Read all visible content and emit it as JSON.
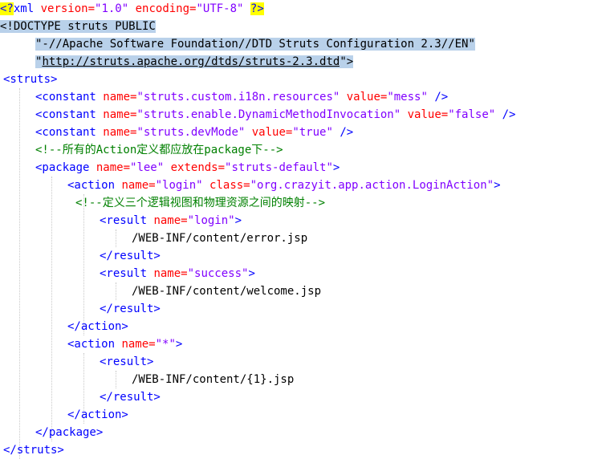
{
  "code_lines": [
    {
      "indent": 0,
      "tokens": [
        {
          "text": "<?",
          "c": "pi",
          "h": "yellow"
        },
        {
          "text": "xml",
          "c": "pi"
        },
        {
          "text": " version=",
          "c": "attr"
        },
        {
          "text": "\"1.0\"",
          "c": "val"
        },
        {
          "text": " encoding=",
          "c": "attr"
        },
        {
          "text": "\"UTF-8\"",
          "c": "val"
        },
        {
          "text": " ",
          "c": "txt"
        },
        {
          "text": "?>",
          "c": "pi",
          "h": "yellow"
        }
      ]
    },
    {
      "indent": 0,
      "tokens": [
        {
          "text": "<!DOCTYPE struts PUBLIC",
          "c": "txt",
          "h": "blue"
        }
      ]
    },
    {
      "indent": 4,
      "tokens": [
        {
          "text": "\"-//Apache Software Foundation//DTD Struts Configuration 2.3//EN\"",
          "c": "txt",
          "h": "blue"
        }
      ]
    },
    {
      "indent": 4,
      "tokens": [
        {
          "text": "\"",
          "c": "txt",
          "h": "blue"
        },
        {
          "text": "http://struts.apache.org/dtds/struts-2.3.dtd",
          "c": "txt",
          "h": "blue",
          "u": true
        },
        {
          "text": "\">",
          "c": "txt",
          "h": "blue"
        }
      ]
    },
    {
      "indent": 0,
      "tokens": [
        {
          "text": "<struts>",
          "c": "tag"
        }
      ]
    },
    {
      "indent": 4,
      "tokens": [
        {
          "text": "<constant",
          "c": "tag"
        },
        {
          "text": " name=",
          "c": "attr"
        },
        {
          "text": "\"struts.custom.i18n.resources\"",
          "c": "val"
        },
        {
          "text": " value=",
          "c": "attr"
        },
        {
          "text": "\"mess\"",
          "c": "val"
        },
        {
          "text": " />",
          "c": "tag"
        }
      ]
    },
    {
      "indent": 4,
      "tokens": [
        {
          "text": "<constant",
          "c": "tag"
        },
        {
          "text": " name=",
          "c": "attr"
        },
        {
          "text": "\"struts.enable.DynamicMethodInvocation\"",
          "c": "val"
        },
        {
          "text": " value=",
          "c": "attr"
        },
        {
          "text": "\"false\"",
          "c": "val"
        },
        {
          "text": " />",
          "c": "tag"
        }
      ]
    },
    {
      "indent": 4,
      "tokens": [
        {
          "text": "<constant",
          "c": "tag"
        },
        {
          "text": " name=",
          "c": "attr"
        },
        {
          "text": "\"struts.devMode\"",
          "c": "val"
        },
        {
          "text": " value=",
          "c": "attr"
        },
        {
          "text": "\"true\"",
          "c": "val"
        },
        {
          "text": " />",
          "c": "tag"
        }
      ]
    },
    {
      "indent": 4,
      "tokens": [
        {
          "text": "<!--所有的Action定义都应放在package下-->",
          "c": "cmt"
        }
      ]
    },
    {
      "indent": 4,
      "tokens": [
        {
          "text": "<package",
          "c": "tag"
        },
        {
          "text": " name=",
          "c": "attr"
        },
        {
          "text": "\"lee\"",
          "c": "val"
        },
        {
          "text": " extends=",
          "c": "attr"
        },
        {
          "text": "\"struts-default\"",
          "c": "val"
        },
        {
          "text": ">",
          "c": "tag"
        }
      ]
    },
    {
      "indent": 8,
      "tokens": [
        {
          "text": "<action",
          "c": "tag"
        },
        {
          "text": " name=",
          "c": "attr"
        },
        {
          "text": "\"login\"",
          "c": "val"
        },
        {
          "text": " class=",
          "c": "attr"
        },
        {
          "text": "\"org.crazyit.app.action.LoginAction\"",
          "c": "val"
        },
        {
          "text": ">",
          "c": "tag"
        }
      ]
    },
    {
      "indent": 9,
      "tokens": [
        {
          "text": "<!--定义三个逻辑视图和物理资源之间的映射-->",
          "c": "cmt"
        }
      ]
    },
    {
      "indent": 12,
      "tokens": [
        {
          "text": "<result",
          "c": "tag"
        },
        {
          "text": " name=",
          "c": "attr"
        },
        {
          "text": "\"login\"",
          "c": "val"
        },
        {
          "text": ">",
          "c": "tag"
        }
      ]
    },
    {
      "indent": 16,
      "tokens": [
        {
          "text": "/WEB-INF/content/error.jsp",
          "c": "txt"
        }
      ]
    },
    {
      "indent": 12,
      "tokens": [
        {
          "text": "</result>",
          "c": "tag"
        }
      ]
    },
    {
      "indent": 12,
      "tokens": [
        {
          "text": "<result",
          "c": "tag"
        },
        {
          "text": " name=",
          "c": "attr"
        },
        {
          "text": "\"success\"",
          "c": "val"
        },
        {
          "text": ">",
          "c": "tag"
        }
      ]
    },
    {
      "indent": 16,
      "tokens": [
        {
          "text": "/WEB-INF/content/welcome.jsp",
          "c": "txt"
        }
      ]
    },
    {
      "indent": 12,
      "tokens": [
        {
          "text": "</result>",
          "c": "tag"
        }
      ]
    },
    {
      "indent": 8,
      "tokens": [
        {
          "text": "</action>",
          "c": "tag"
        }
      ]
    },
    {
      "indent": 8,
      "tokens": [
        {
          "text": "<action",
          "c": "tag"
        },
        {
          "text": " name=",
          "c": "attr"
        },
        {
          "text": "\"*\"",
          "c": "val"
        },
        {
          "text": ">",
          "c": "tag"
        }
      ]
    },
    {
      "indent": 12,
      "tokens": [
        {
          "text": "<result>",
          "c": "tag"
        }
      ]
    },
    {
      "indent": 16,
      "tokens": [
        {
          "text": "/WEB-INF/content/{1}.jsp",
          "c": "txt"
        }
      ]
    },
    {
      "indent": 12,
      "tokens": [
        {
          "text": "</result>",
          "c": "tag"
        }
      ]
    },
    {
      "indent": 8,
      "tokens": [
        {
          "text": "</action>",
          "c": "tag"
        }
      ]
    },
    {
      "indent": 4,
      "tokens": [
        {
          "text": "</package>",
          "c": "tag"
        }
      ]
    },
    {
      "indent": 0,
      "tokens": [
        {
          "text": "</struts>",
          "c": "tag"
        }
      ]
    }
  ],
  "colors": {
    "tag": "#0000ff",
    "attribute": "#ff0000",
    "value": "#8000ff",
    "comment": "#008000",
    "text": "#000000",
    "pi_highlight": "#ffff00",
    "selection_highlight": "#b9d1ea",
    "indent_guide": "#c8c8c8"
  }
}
